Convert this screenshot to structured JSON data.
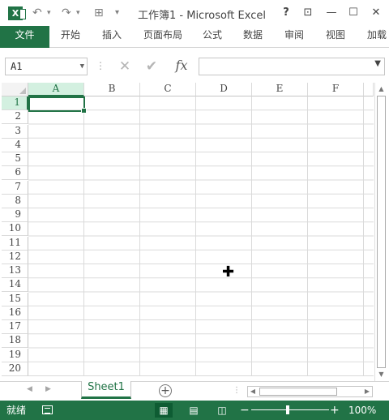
{
  "titlebar": {
    "title": "工作簿1 - Microsoft Excel",
    "app_icon": "excel-icon",
    "help": "?",
    "ribbon_display": "⊡",
    "minimize": "—",
    "maximize": "☐",
    "close": "✕"
  },
  "qat": {
    "undo": "↶",
    "redo": "↷",
    "borders": "⊞",
    "customize": "₹",
    "dropdown": "▾"
  },
  "ribbon": {
    "tabs": [
      "文件",
      "开始",
      "插入",
      "页面布局",
      "公式",
      "数据",
      "审阅",
      "视图",
      "加载"
    ]
  },
  "formula_bar": {
    "name_box": "A1",
    "cancel": "✕",
    "enter": "✔",
    "fx": "fx",
    "content": ""
  },
  "grid": {
    "columns": [
      "A",
      "B",
      "C",
      "D",
      "E",
      "F"
    ],
    "rows": [
      "1",
      "2",
      "3",
      "4",
      "5",
      "6",
      "7",
      "8",
      "9",
      "10",
      "11",
      "12",
      "13",
      "14",
      "15",
      "16",
      "17",
      "18",
      "19",
      "20"
    ],
    "selected_cell": "A1"
  },
  "sheets": {
    "tabs": [
      "Sheet1"
    ],
    "active": "Sheet1",
    "add": "+"
  },
  "statusbar": {
    "status": "就绪",
    "zoom_level": "100%",
    "zoom_minus": "−",
    "zoom_plus": "+"
  },
  "colors": {
    "accent": "#217346",
    "header_highlight": "#d3f0e0"
  }
}
